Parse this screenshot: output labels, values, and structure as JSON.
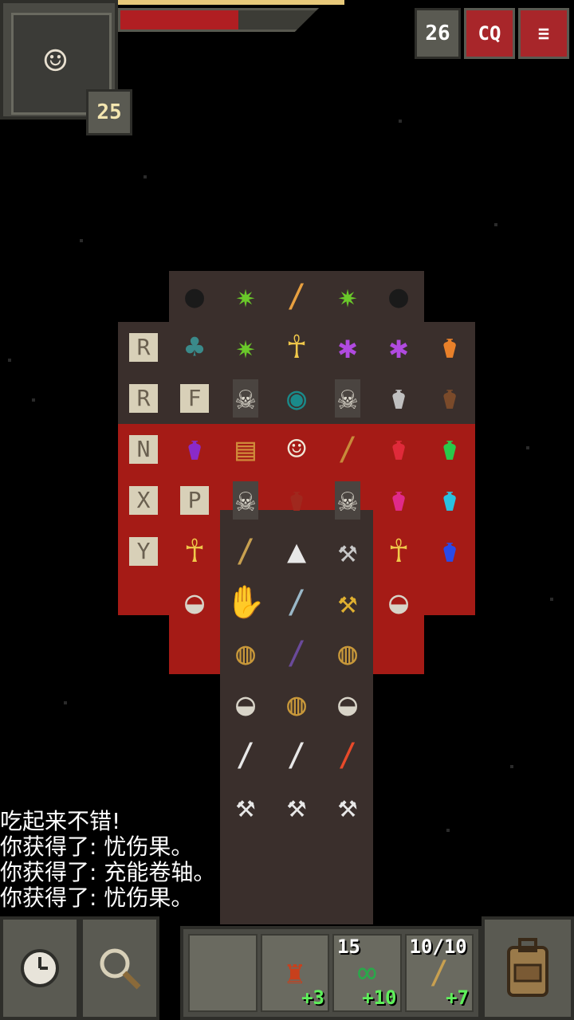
{
  "hud": {
    "hero_level": "25",
    "depth": "26",
    "journal_label": "CQ",
    "menu_label": "≡",
    "hp_fraction": 0.6,
    "xp_fraction": 0.6
  },
  "colors": {
    "lava": "#a51b16",
    "floor": "#3a2f2c",
    "panel": "#5a5a52",
    "accent_button": "#a8262a",
    "hp": "#b01e22",
    "xp": "#e8c97a",
    "bonus_text": "#5ef05a"
  },
  "items": [
    {
      "name": "bomb",
      "icon": "●"
    },
    {
      "name": "plant",
      "icon": "✷"
    },
    {
      "name": "torch",
      "icon": "/"
    },
    {
      "name": "plant",
      "icon": "✷"
    },
    {
      "name": "bomb",
      "icon": "●"
    },
    {
      "name": "rune-stone",
      "icon": "R"
    },
    {
      "name": "grass",
      "icon": "♣"
    },
    {
      "name": "plant",
      "icon": "✷"
    },
    {
      "name": "ankh",
      "icon": "☥"
    },
    {
      "name": "flower",
      "icon": "✱"
    },
    {
      "name": "flower",
      "icon": "✱"
    },
    {
      "name": "potion-orange",
      "icon": "⚱"
    },
    {
      "name": "rune-stone",
      "icon": "R"
    },
    {
      "name": "rune-stone",
      "icon": "F"
    },
    {
      "name": "skeleton",
      "icon": "☠"
    },
    {
      "name": "seed-pouch",
      "icon": "◉"
    },
    {
      "name": "skeleton",
      "icon": "☠"
    },
    {
      "name": "potion-grey",
      "icon": "⚱"
    },
    {
      "name": "potion-brown",
      "icon": "⚱"
    },
    {
      "name": "rune-stone",
      "icon": "N"
    },
    {
      "name": "potion-purple",
      "icon": "⚱"
    },
    {
      "name": "scroll",
      "icon": "▤"
    },
    {
      "name": "hero",
      "icon": "☺"
    },
    {
      "name": "wand",
      "icon": "/"
    },
    {
      "name": "potion-red",
      "icon": "⚱"
    },
    {
      "name": "potion-green",
      "icon": "⚱"
    },
    {
      "name": "rune-stone",
      "icon": "X"
    },
    {
      "name": "rune-stone",
      "icon": "P"
    },
    {
      "name": "skeleton",
      "icon": "☠"
    },
    {
      "name": "potion-jar",
      "icon": "⚱"
    },
    {
      "name": "skeleton",
      "icon": "☠"
    },
    {
      "name": "potion-pink",
      "icon": "⚱"
    },
    {
      "name": "potion-cyan",
      "icon": "⚱"
    },
    {
      "name": "rune-stone",
      "icon": "Y"
    },
    {
      "name": "ankh",
      "icon": "☥"
    },
    {
      "name": "spear",
      "icon": "/"
    },
    {
      "name": "dart",
      "icon": "▲"
    },
    {
      "name": "axe",
      "icon": "⚒"
    },
    {
      "name": "ankh",
      "icon": "☥"
    },
    {
      "name": "potion-blue",
      "icon": "⚱"
    },
    {
      "name": "stone",
      "icon": "◒"
    },
    {
      "name": "glove",
      "icon": "✋"
    },
    {
      "name": "sword",
      "icon": "/"
    },
    {
      "name": "hammer",
      "icon": "⚒"
    },
    {
      "name": "stone",
      "icon": "◒"
    },
    {
      "name": "pouch",
      "icon": "◍"
    },
    {
      "name": "whip",
      "icon": "/"
    },
    {
      "name": "pouch",
      "icon": "◍"
    },
    {
      "name": "stone",
      "icon": "◒"
    },
    {
      "name": "pouch",
      "icon": "◍"
    },
    {
      "name": "stone",
      "icon": "◒"
    },
    {
      "name": "dart",
      "icon": "/"
    },
    {
      "name": "dart",
      "icon": "/"
    },
    {
      "name": "fire-wand",
      "icon": "/"
    },
    {
      "name": "throwing-hammer",
      "icon": "⚒"
    },
    {
      "name": "throwing-hammer",
      "icon": "⚒"
    },
    {
      "name": "throwing-hammer",
      "icon": "⚒"
    }
  ],
  "log": [
    "吃起来不错!",
    "你获得了: 忧伤果。",
    "你获得了: 充能卷轴。",
    "你获得了: 忧伤果。"
  ],
  "toolbar": {
    "wait_icon": "clock-icon",
    "search_icon": "magnifier-icon",
    "backpack_icon": "backpack-icon",
    "quickslots": [
      {
        "name": "empty",
        "icon": "",
        "count": "",
        "bonus": ""
      },
      {
        "name": "armor",
        "icon": "♜",
        "count": "",
        "bonus": "+3"
      },
      {
        "name": "chain",
        "icon": "∞",
        "count": "15",
        "bonus": "+10"
      },
      {
        "name": "wand",
        "icon": "/",
        "count": "10/10",
        "bonus": "+7"
      }
    ]
  }
}
